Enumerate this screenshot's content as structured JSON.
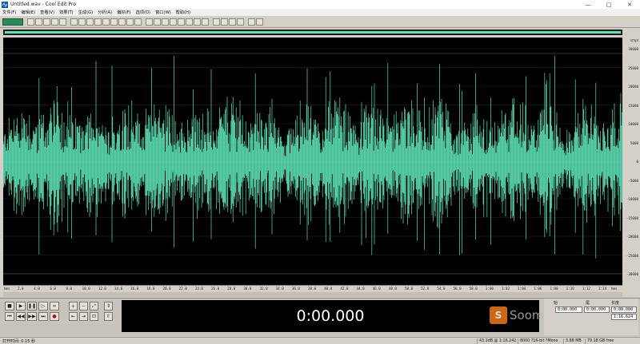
{
  "window": {
    "title": "Untitled.wav - Cool Edit Pro",
    "minimize": "—",
    "maximize": "□",
    "close": "✕"
  },
  "menu": [
    "文件(F)",
    "编辑(E)",
    "查看(V)",
    "效果(T)",
    "生成(G)",
    "分析(A)",
    "偏好(F)",
    "选项(O)",
    "窗口(W)",
    "帮助(H)"
  ],
  "colors": {
    "waveform": "#5de0b6",
    "wave_bg": "#000000",
    "chrome": "#d4d0c8"
  },
  "waveform": {
    "amp_unit": "smpl",
    "amp_ticks": [
      "30000",
      "25000",
      "20000",
      "15000",
      "10000",
      "5000",
      "0",
      "-5000",
      "-10000",
      "-15000",
      "-20000",
      "-25000",
      "-30000"
    ],
    "time_unit": "hms",
    "time_ticks": [
      "2.0",
      "4.0",
      "6.0",
      "8.0",
      "10.0",
      "12.0",
      "14.0",
      "16.0",
      "18.0",
      "20.0",
      "22.0",
      "24.0",
      "26.0",
      "28.0",
      "30.0",
      "32.0",
      "34.0",
      "36.0",
      "38.0",
      "40.0",
      "42.0",
      "44.0",
      "46.0",
      "48.0",
      "50.0",
      "52.0",
      "54.0",
      "56.0",
      "58.0",
      "1:00",
      "1:02",
      "1:04",
      "1:06",
      "1:08",
      "1:10",
      "1:12",
      "1:14"
    ]
  },
  "transport": {
    "time": "0:00.000",
    "buttons": [
      "stop",
      "play",
      "pause",
      "play-to-end",
      "loop",
      "go-start",
      "rewind",
      "fast-forward",
      "go-end",
      "record"
    ]
  },
  "selection": {
    "begin_label": "始",
    "end_label": "尾",
    "length_label": "长度",
    "sel_begin": "0:00.000",
    "sel_end": "0:00.000",
    "sel_length": "0:00.000",
    "view_length": "1:16.624"
  },
  "watermark": {
    "text": "Soomal.com"
  },
  "status": {
    "left": "打开时间: 0.15 秒",
    "level": "43.1dB @ 1:16.242",
    "format": "8000 ?16-bit ?Mono",
    "size": "3.66 MB",
    "free": "79.18 GB free"
  }
}
